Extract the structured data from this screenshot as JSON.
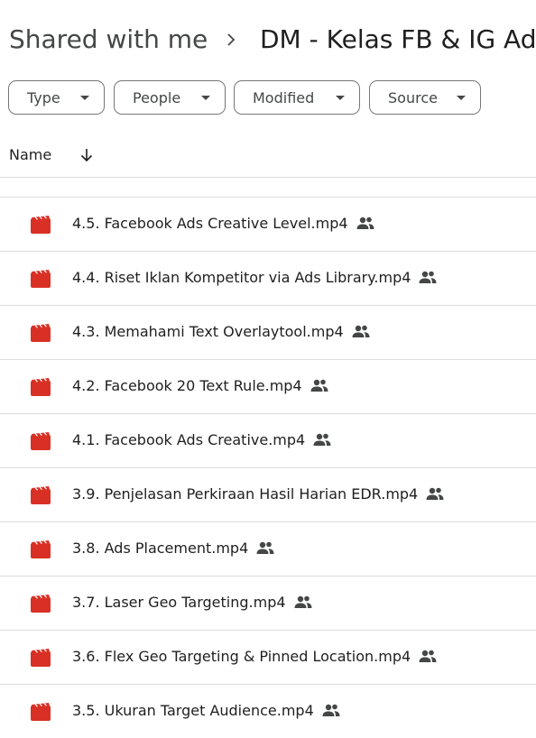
{
  "breadcrumb": {
    "root": "Shared with me",
    "separator_icon": "chevron-right-icon",
    "current": "DM - Kelas FB & IG Ads"
  },
  "filters": [
    {
      "label": "Type"
    },
    {
      "label": "People"
    },
    {
      "label": "Modified"
    },
    {
      "label": "Source"
    }
  ],
  "columns": {
    "name": "Name",
    "sort_icon": "arrow-down-icon"
  },
  "colors": {
    "video_icon": "#d93025",
    "text": "#1f1f1f",
    "muted": "#444746",
    "divider": "#dadce0"
  },
  "files": [
    {
      "name": "4.5. Facebook Ads Creative Level.mp4",
      "icon": "video-file-icon",
      "shared": true
    },
    {
      "name": "4.4. Riset Iklan Kompetitor via Ads Library.mp4",
      "icon": "video-file-icon",
      "shared": true
    },
    {
      "name": "4.3. Memahami Text Overlaytool.mp4",
      "icon": "video-file-icon",
      "shared": true
    },
    {
      "name": "4.2. Facebook 20 Text Rule.mp4",
      "icon": "video-file-icon",
      "shared": true
    },
    {
      "name": "4.1. Facebook Ads Creative.mp4",
      "icon": "video-file-icon",
      "shared": true
    },
    {
      "name": "3.9. Penjelasan Perkiraan Hasil Harian EDR.mp4",
      "icon": "video-file-icon",
      "shared": true
    },
    {
      "name": "3.8. Ads Placement.mp4",
      "icon": "video-file-icon",
      "shared": true
    },
    {
      "name": "3.7. Laser Geo Targeting.mp4",
      "icon": "video-file-icon",
      "shared": true
    },
    {
      "name": "3.6. Flex Geo Targeting & Pinned Location.mp4",
      "icon": "video-file-icon",
      "shared": true
    },
    {
      "name": "3.5. Ukuran Target Audience.mp4",
      "icon": "video-file-icon",
      "shared": true
    }
  ]
}
